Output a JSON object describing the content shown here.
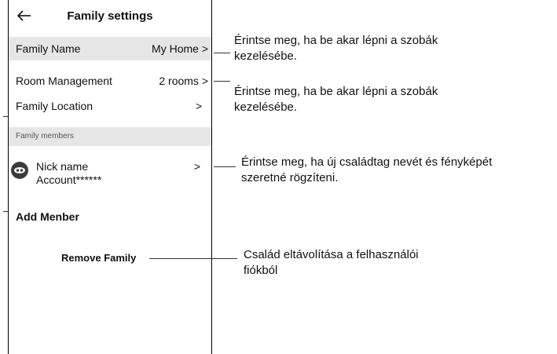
{
  "header": {
    "title": "Family settings",
    "back_icon": "back-arrow-icon"
  },
  "family_name": {
    "label": "Family Name",
    "value": "My Home >"
  },
  "room_management": {
    "label": "Room Management",
    "value": "2 rooms >"
  },
  "family_location": {
    "label": "Family Location",
    "value": ">"
  },
  "family_members": {
    "section_title": "Family members",
    "members": [
      {
        "name": "Nick name",
        "account": "Account******",
        "chevron": ">"
      }
    ]
  },
  "add_member": {
    "label": "Add Menber"
  },
  "remove_family": {
    "label": "Remove Family"
  },
  "annotations": {
    "family_name": [
      "Érintse meg, ha be akar lépni a szobák",
      "kezelésébe."
    ],
    "room_management": [
      "Érintse meg, ha be akar lépni a szobák",
      "kezelésébe."
    ],
    "member": [
      "Érintse meg, ha új családtag nevét és fényképét",
      "szeretné rögzíteni."
    ],
    "remove_family": [
      "Család eltávolítása a felhasználói",
      "fiókból"
    ]
  }
}
